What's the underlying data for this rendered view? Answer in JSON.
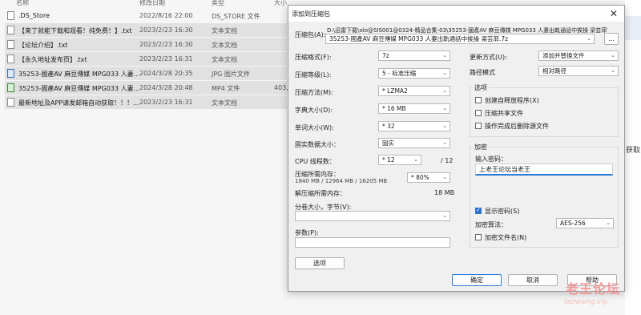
{
  "explorer": {
    "headers": {
      "name": "名称",
      "date": "修改日期",
      "type": "类型",
      "size": "大小"
    },
    "rows": [
      {
        "name": ".DS_Store",
        "date": "2022/8/16 22:00",
        "type": "DS_STORE 文件",
        "size": "",
        "icon": "file-icon",
        "selected": false
      },
      {
        "name": "【来了就能下载和观看！纯免费！】.txt",
        "date": "2023/2/23 16:30",
        "type": "文本文档",
        "size": "",
        "icon": "text-file-icon",
        "selected": true
      },
      {
        "name": "【论坛介绍】.txt",
        "date": "2023/2/23 16:30",
        "type": "文本文档",
        "size": "",
        "icon": "text-file-icon",
        "selected": true
      },
      {
        "name": "【永久地址发布页】.txt",
        "date": "2023/2/23 16:31",
        "type": "文本文档",
        "size": "",
        "icon": "text-file-icon",
        "selected": true
      },
      {
        "name": "35253-國產AV 麻豆傳媒 MPG033 人妻...",
        "date": "2024/3/28 20:35",
        "type": "JPG 图片文件",
        "size": "",
        "icon": "image-file-icon",
        "selected": true
      },
      {
        "name": "35253-國產AV 麻豆傳媒 MPG033 人妻...",
        "date": "2024/3/28 20:48",
        "type": "MP4 文件",
        "size": "403,",
        "icon": "video-file-icon",
        "selected": true
      },
      {
        "name": "最新地址及APP请发邮箱自动获取！！！...",
        "date": "2023/2/23 16:31",
        "type": "文本文档",
        "size": "",
        "icon": "text-file-icon",
        "selected": true
      }
    ],
    "right_text": "获取"
  },
  "dialog": {
    "title": "添加到压缩包",
    "archive_label": "压缩包(A):",
    "archive_path": "D:\\迅雷下载\\olo@SIS001@0324-精品合集-03\\35253-國產AV 麻豆傳媒 MPG033 人妻出軌通話中挨操 梁芸菲\\",
    "archive_name": "35253-國產AV 麻豆傳媒 MPG033 人妻出軌通話中挨操 梁芸菲.7z",
    "browse_label": "...",
    "left": [
      {
        "label": "压缩格式(F):",
        "value": "7z"
      },
      {
        "label": "压缩等级(L):",
        "value": "5 - 标准压缩"
      },
      {
        "label": "压缩方法(M):",
        "value": "* LZMA2"
      },
      {
        "label": "字典大小(D):",
        "value": "* 16 MB"
      },
      {
        "label": "单词大小(W):",
        "value": "* 32"
      },
      {
        "label": "固实数据大小：",
        "value": "固实"
      },
      {
        "label": "CPU 线程数：",
        "value": "* 12"
      }
    ],
    "cpu_total": "/ 12",
    "mem_label": "压缩所需内存：",
    "mem_detail": "1840 MB / 12964 MB / 16205 MB",
    "mem_value": "* 80%",
    "decomp_label": "解压缩所需内存：",
    "decomp_value": "18 MB",
    "split_label": "分卷大小，字节(V):",
    "params_label": "参数(P):",
    "options_button": "选项",
    "update_label": "更新方式(U):",
    "update_value": "添加并替换文件",
    "path_label": "路径模式",
    "path_value": "相对路径",
    "options_group": "选项",
    "opt_sfx": "创建自释放程序(X)",
    "opt_shared": "压缩共享文件",
    "opt_delete": "操作完成后删除源文件",
    "encrypt_group": "加密",
    "pwd_label": "输入密码：",
    "pwd_value": "上老王论坛当老王",
    "show_pwd": "显示密码(S)",
    "enc_method_label": "加密算法：",
    "enc_method_value": "AES-256",
    "enc_names": "加密文件名(N)",
    "ok": "确定",
    "cancel": "取消",
    "help": "帮助"
  },
  "watermark": {
    "main": "老王论坛",
    "sub": "laowang.vip"
  }
}
